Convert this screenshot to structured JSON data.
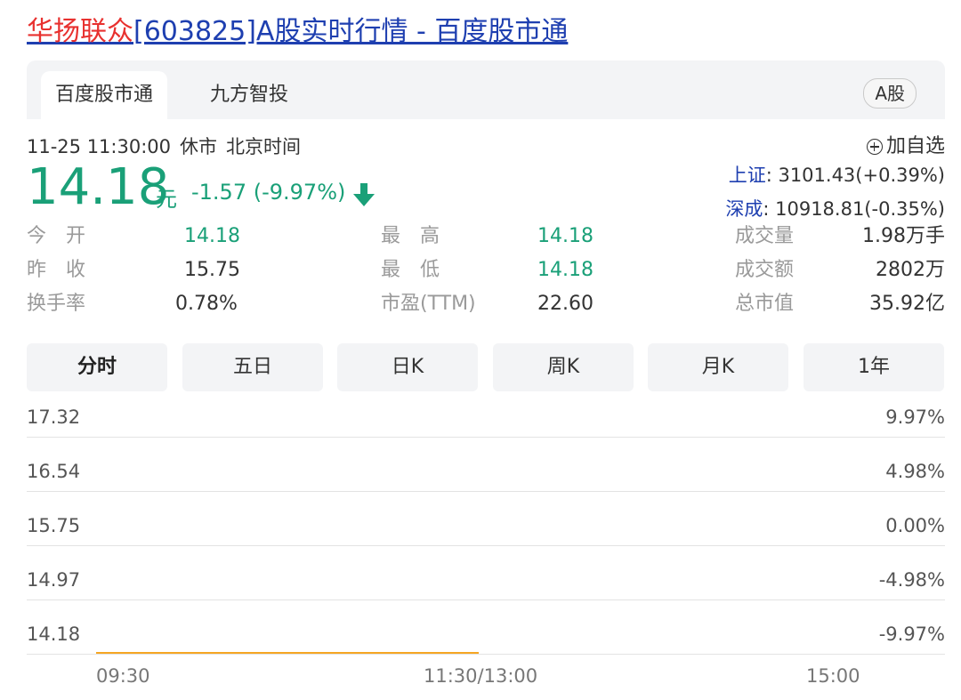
{
  "page": {
    "stock_name": "华扬联众",
    "title_rest": "[603825]A股实时行情 - 百度股市通"
  },
  "tabs": {
    "active": "百度股市通",
    "second": "九方智投",
    "market_badge": "A股"
  },
  "quote": {
    "datetime": "11-25 11:30:00",
    "status": "休市",
    "timezone": "北京时间",
    "price": "14.18",
    "unit": "元",
    "change": "-1.57 (-9.97%)",
    "trend_icon": "arrow-down-icon"
  },
  "watchlist": {
    "label": "加自选"
  },
  "indices": [
    {
      "name": "上证",
      "value": ": 3101.43(+0.39%)"
    },
    {
      "name": "深成",
      "value": ": 10918.81(-0.35%)"
    }
  ],
  "stats": {
    "open": {
      "label": "今　开",
      "value": "14.18"
    },
    "prev": {
      "label": "昨　收",
      "value": "15.75"
    },
    "turn": {
      "label": "换手率",
      "value": "0.78%"
    },
    "high": {
      "label": "最　高",
      "value": "14.18"
    },
    "low": {
      "label": "最　低",
      "value": "14.18"
    },
    "pe": {
      "label": "市盈(TTM)",
      "value": "22.60"
    },
    "volume": {
      "label": "成交量",
      "value": "1.98万手"
    },
    "amount": {
      "label": "成交额",
      "value": "2802万"
    },
    "mcap": {
      "label": "总市值",
      "value": "35.92亿"
    }
  },
  "timeframes": [
    "分时",
    "五日",
    "日K",
    "周K",
    "月K",
    "1年"
  ],
  "active_timeframe": "分时",
  "chart_data": {
    "type": "line",
    "y_ticks_left": [
      "17.32",
      "16.54",
      "15.75",
      "14.97",
      "14.18"
    ],
    "y_ticks_right": [
      "9.97%",
      "4.98%",
      "0.00%",
      "-4.98%",
      "-9.97%"
    ],
    "x_ticks": [
      "09:30",
      "11:30/13:00",
      "15:00"
    ],
    "ylim": [
      14.18,
      17.32
    ],
    "series": [
      {
        "x": [
          "09:30",
          "11:30"
        ],
        "values": [
          14.18,
          14.18
        ]
      }
    ],
    "colors": {
      "line": "#f5a623"
    }
  },
  "colors": {
    "down": "#1aa078",
    "link": "#1e3fb0",
    "stock_name": "#e8312f"
  }
}
